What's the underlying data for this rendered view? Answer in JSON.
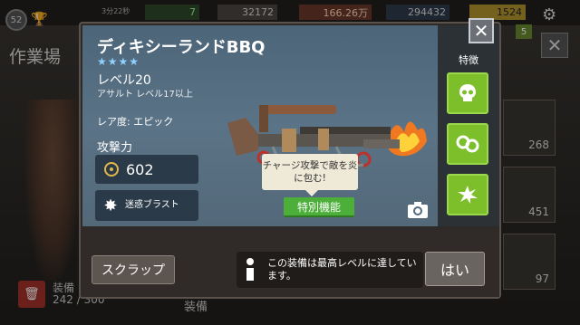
{
  "background": {
    "player_level": "52",
    "resource_small_label": "3分22秒",
    "resources": [
      "7",
      "32172",
      "166.26万",
      "294432",
      "1524"
    ],
    "title": "作業場",
    "badge": "5",
    "cards": [
      "268",
      "451",
      "97"
    ],
    "equip_label": "装備",
    "equip_count": "242 / 300",
    "equip_bottom": "装備"
  },
  "weapon": {
    "name": "ディキシーランドBBQ",
    "stars": "★★★★",
    "level": "レベル20",
    "subtype": "アサルト レベル17以上",
    "rarity": "レア度: エピック",
    "attack_label": "攻撃力",
    "attack_value": "602",
    "skill_name": "迷惑ブラスト",
    "tooltip": "チャージ攻撃で敵を炎に包む!",
    "special_button": "特別機能"
  },
  "features": {
    "label": "特徴",
    "icons": [
      "skull-icon",
      "orbs-icon",
      "burst-icon"
    ]
  },
  "footer": {
    "scrap_button": "スクラップ",
    "message": "この装備は最高レベルに達しています。",
    "yes_button": "はい"
  },
  "colors": {
    "feature_green": "#7cbf2b",
    "special_green": "#4caf3a",
    "panel_blue": "#5b7386"
  }
}
